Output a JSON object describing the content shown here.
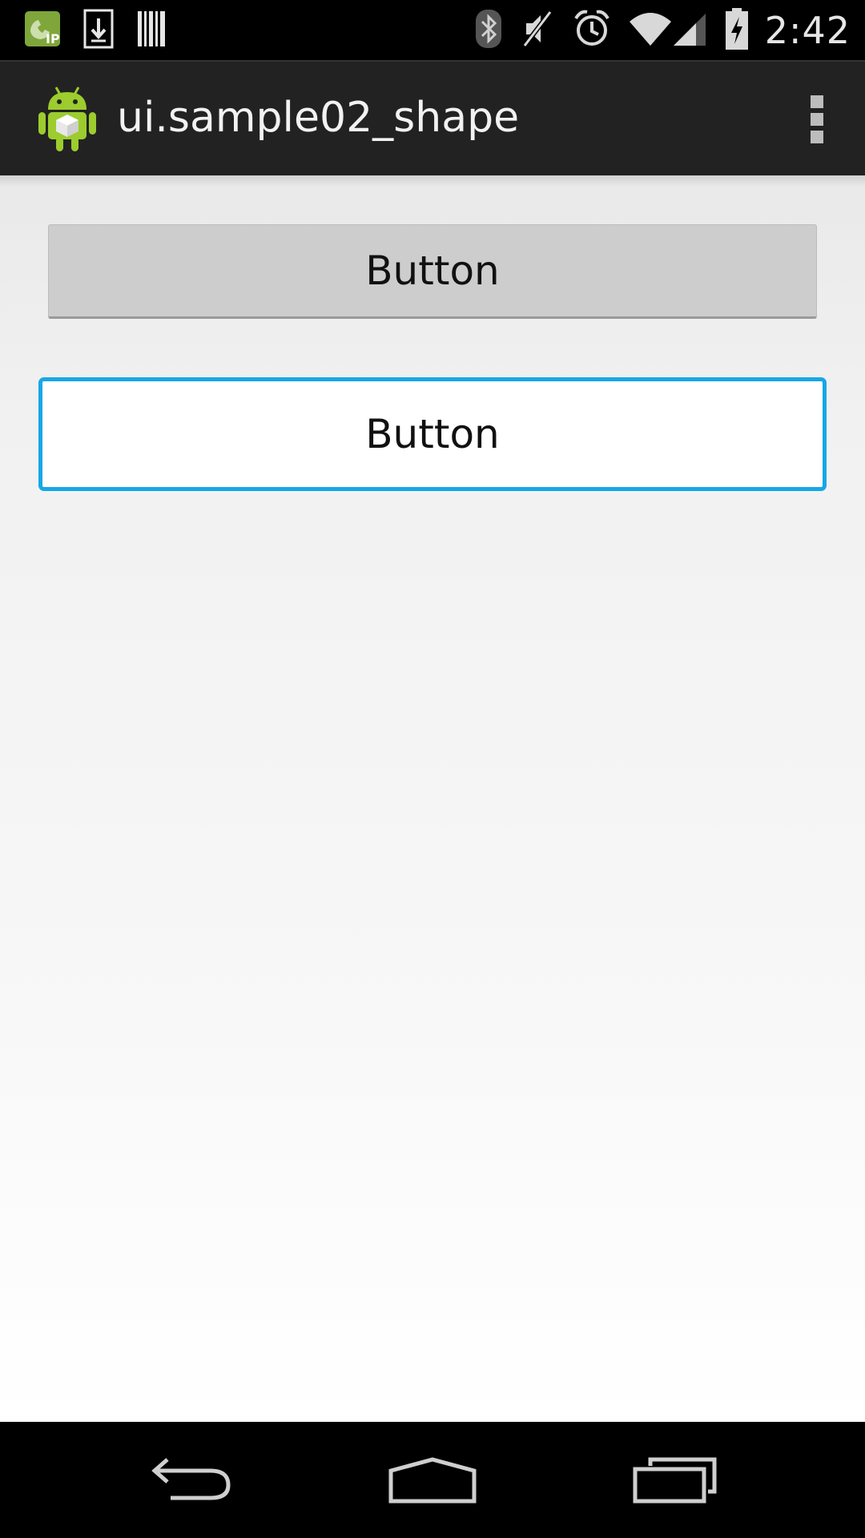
{
  "status_bar": {
    "left_icons": [
      "voip-call-icon",
      "download-icon",
      "barcode-icon"
    ],
    "right_icons": [
      "bluetooth-icon",
      "mute-icon",
      "alarm-icon",
      "wifi-icon",
      "signal-icon",
      "battery-charging-icon"
    ],
    "time": "2:42"
  },
  "action_bar": {
    "title": "ui.sample02_shape",
    "logo": "android-app-icon",
    "overflow": "overflow-menu-icon"
  },
  "buttons": [
    {
      "label": "Button",
      "style": "default"
    },
    {
      "label": "Button",
      "style": "blue-outline-shape"
    }
  ],
  "colors": {
    "action_bar": "#222222",
    "content_bg": "#f1f1f1",
    "button_default": "#cdcdcd",
    "button_shape_border": "#17a7e6",
    "button_shape_fill": "#ffffff"
  },
  "nav_bar": {
    "icons": [
      "back-icon",
      "home-icon",
      "recents-icon"
    ]
  }
}
